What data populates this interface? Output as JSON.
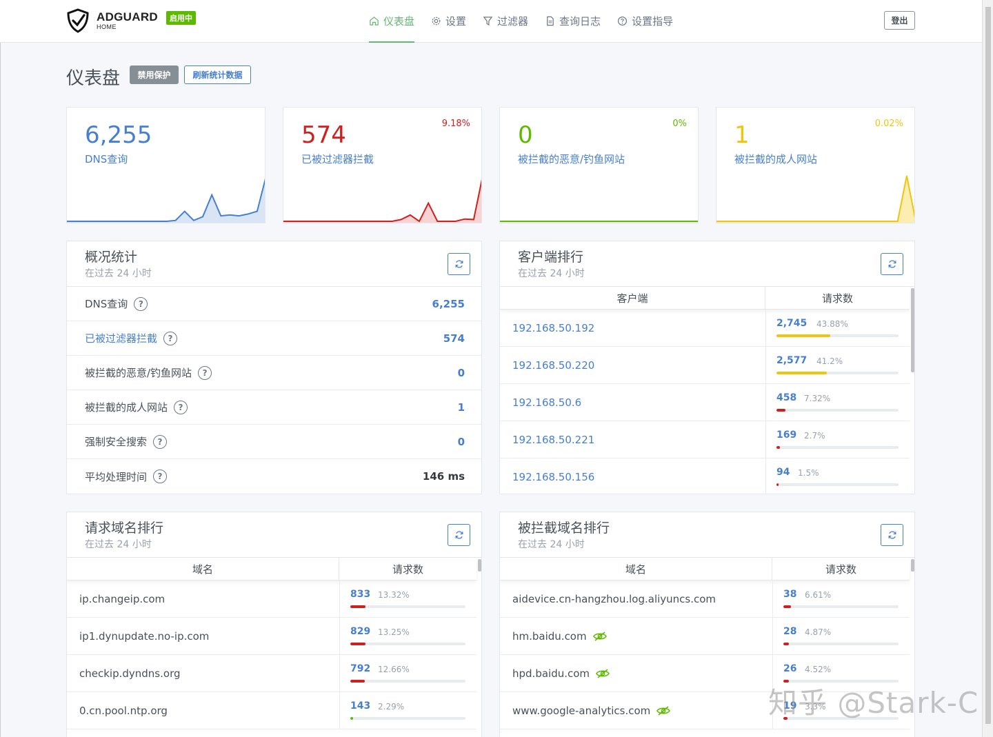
{
  "brand": {
    "name": "ADGUARD",
    "sub": "HOME",
    "status_badge": "启用中"
  },
  "nav": {
    "items": [
      {
        "label": "仪表盘",
        "icon": "home-icon",
        "active": true
      },
      {
        "label": "设置",
        "icon": "gear-icon"
      },
      {
        "label": "过滤器",
        "icon": "filter-icon"
      },
      {
        "label": "查询日志",
        "icon": "document-icon"
      },
      {
        "label": "设置指导",
        "icon": "help-circle-icon"
      }
    ],
    "logout": "登出"
  },
  "page": {
    "title": "仪表盘",
    "disable_btn": "禁用保护",
    "refresh_btn": "刷新统计数据"
  },
  "stats": [
    {
      "value": "6,255",
      "label": "DNS查询",
      "pct": "",
      "color": "#467fcf",
      "fill": "#d9e4f5",
      "series": [
        0,
        0,
        0,
        0,
        0,
        0,
        0,
        0,
        0,
        0,
        0,
        0,
        0.02,
        0.22,
        0.02,
        0.1,
        0.58,
        0.12,
        0.14,
        0.12,
        0.16,
        0.22,
        1.0
      ]
    },
    {
      "value": "574",
      "label": "已被过滤器拦截",
      "pct": "9.18%",
      "color": "#cd201f",
      "fill": "#f7d3d3",
      "series": [
        0,
        0,
        0,
        0,
        0,
        0,
        0,
        0,
        0,
        0,
        0,
        0,
        0,
        0.04,
        0.14,
        0,
        0.4,
        0,
        0,
        0,
        0.05,
        0.04,
        1.0
      ]
    },
    {
      "value": "0",
      "label": "被拦截的恶意/钓鱼网站",
      "pct": "0%",
      "color": "#5eba00",
      "fill": "#e6f4d6",
      "series": [
        0,
        0,
        0,
        0,
        0,
        0,
        0,
        0,
        0,
        0,
        0,
        0,
        0,
        0,
        0,
        0,
        0,
        0,
        0,
        0,
        0,
        0,
        0
      ]
    },
    {
      "value": "1",
      "label": "被拦截的成人网站",
      "pct": "0.02%",
      "color": "#f1c40f",
      "fill": "#fbeeb0",
      "series": [
        0,
        0,
        0,
        0,
        0,
        0,
        0,
        0,
        0,
        0,
        0,
        0,
        0,
        0,
        0,
        0,
        0,
        0,
        0,
        0,
        0,
        1.0,
        0
      ]
    }
  ],
  "overview": {
    "title": "概况统计",
    "subtitle": "在过去 24 小时",
    "rows": [
      {
        "label": "DNS查询",
        "value": "6,255"
      },
      {
        "label": "已被过滤器拦截",
        "value": "574"
      },
      {
        "label": "被拦截的恶意/钓鱼网站",
        "value": "0"
      },
      {
        "label": "被拦截的成人网站",
        "value": "1"
      },
      {
        "label": "强制安全搜索",
        "value": "0"
      },
      {
        "label": "平均处理时间",
        "value": "146 ms"
      }
    ]
  },
  "clients": {
    "title": "客户端排行",
    "subtitle": "在过去 24 小时",
    "col_name": "客户端",
    "col_count": "请求数",
    "rows": [
      {
        "name": "192.168.50.192",
        "count": "2,745",
        "pct": "43.88%",
        "frac": 0.4388,
        "color": "#f1c40f"
      },
      {
        "name": "192.168.50.220",
        "count": "2,577",
        "pct": "41.2%",
        "frac": 0.412,
        "color": "#f1c40f"
      },
      {
        "name": "192.168.50.6",
        "count": "458",
        "pct": "7.32%",
        "frac": 0.0732,
        "color": "#cd201f"
      },
      {
        "name": "192.168.50.221",
        "count": "169",
        "pct": "2.7%",
        "frac": 0.027,
        "color": "#cd201f"
      },
      {
        "name": "192.168.50.156",
        "count": "94",
        "pct": "1.5%",
        "frac": 0.015,
        "color": "#cd201f"
      }
    ]
  },
  "queried": {
    "title": "请求域名排行",
    "subtitle": "在过去 24 小时",
    "col_name": "域名",
    "col_count": "请求数",
    "rows": [
      {
        "name": "ip.changeip.com",
        "count": "833",
        "pct": "13.32%",
        "frac": 0.1332,
        "color": "#cd201f"
      },
      {
        "name": "ip1.dynupdate.no-ip.com",
        "count": "829",
        "pct": "13.25%",
        "frac": 0.1325,
        "color": "#cd201f"
      },
      {
        "name": "checkip.dyndns.org",
        "count": "792",
        "pct": "12.66%",
        "frac": 0.1266,
        "color": "#cd201f"
      },
      {
        "name": "0.cn.pool.ntp.org",
        "count": "143",
        "pct": "2.29%",
        "frac": 0.0229,
        "color": "#5eba00"
      }
    ]
  },
  "blocked": {
    "title": "被拦截域名排行",
    "subtitle": "在过去 24 小时",
    "col_name": "域名",
    "col_count": "请求数",
    "rows": [
      {
        "name": "aidevice.cn-hangzhou.log.aliyuncs.com",
        "count": "38",
        "pct": "6.61%",
        "frac": 0.0661,
        "color": "#cd201f",
        "eye": false
      },
      {
        "name": "hm.baidu.com",
        "count": "28",
        "pct": "4.87%",
        "frac": 0.0487,
        "color": "#cd201f",
        "eye": true
      },
      {
        "name": "hpd.baidu.com",
        "count": "26",
        "pct": "4.52%",
        "frac": 0.0452,
        "color": "#cd201f",
        "eye": true
      },
      {
        "name": "www.google-analytics.com",
        "count": "19",
        "pct": "3.3%",
        "frac": 0.033,
        "color": "#cd201f",
        "eye": true
      }
    ]
  },
  "watermark": "知乎 @Stark-C"
}
